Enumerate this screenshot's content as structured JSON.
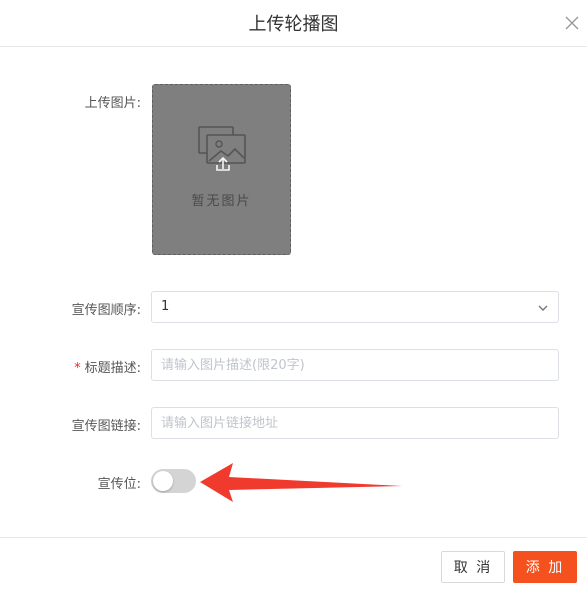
{
  "dialog": {
    "title": "上传轮播图",
    "close_icon": "close-icon"
  },
  "form": {
    "upload": {
      "label": "上传图片:",
      "empty_text": "暂无图片",
      "icon": "image-upload-icon"
    },
    "order": {
      "label": "宣传图顺序:",
      "value": "1",
      "icon": "chevron-down-icon"
    },
    "title_desc": {
      "required_mark": "*",
      "label": "标题描述:",
      "placeholder": "请输入图片描述(限20字)"
    },
    "link": {
      "label": "宣传图链接:",
      "placeholder": "请输入图片链接地址"
    },
    "position": {
      "label": "宣传位:",
      "enabled": false
    }
  },
  "annotation": {
    "arrow_color": "#f03a2e"
  },
  "footer": {
    "cancel_label": "取 消",
    "add_label": "添 加",
    "accent_color": "#f4511e"
  }
}
